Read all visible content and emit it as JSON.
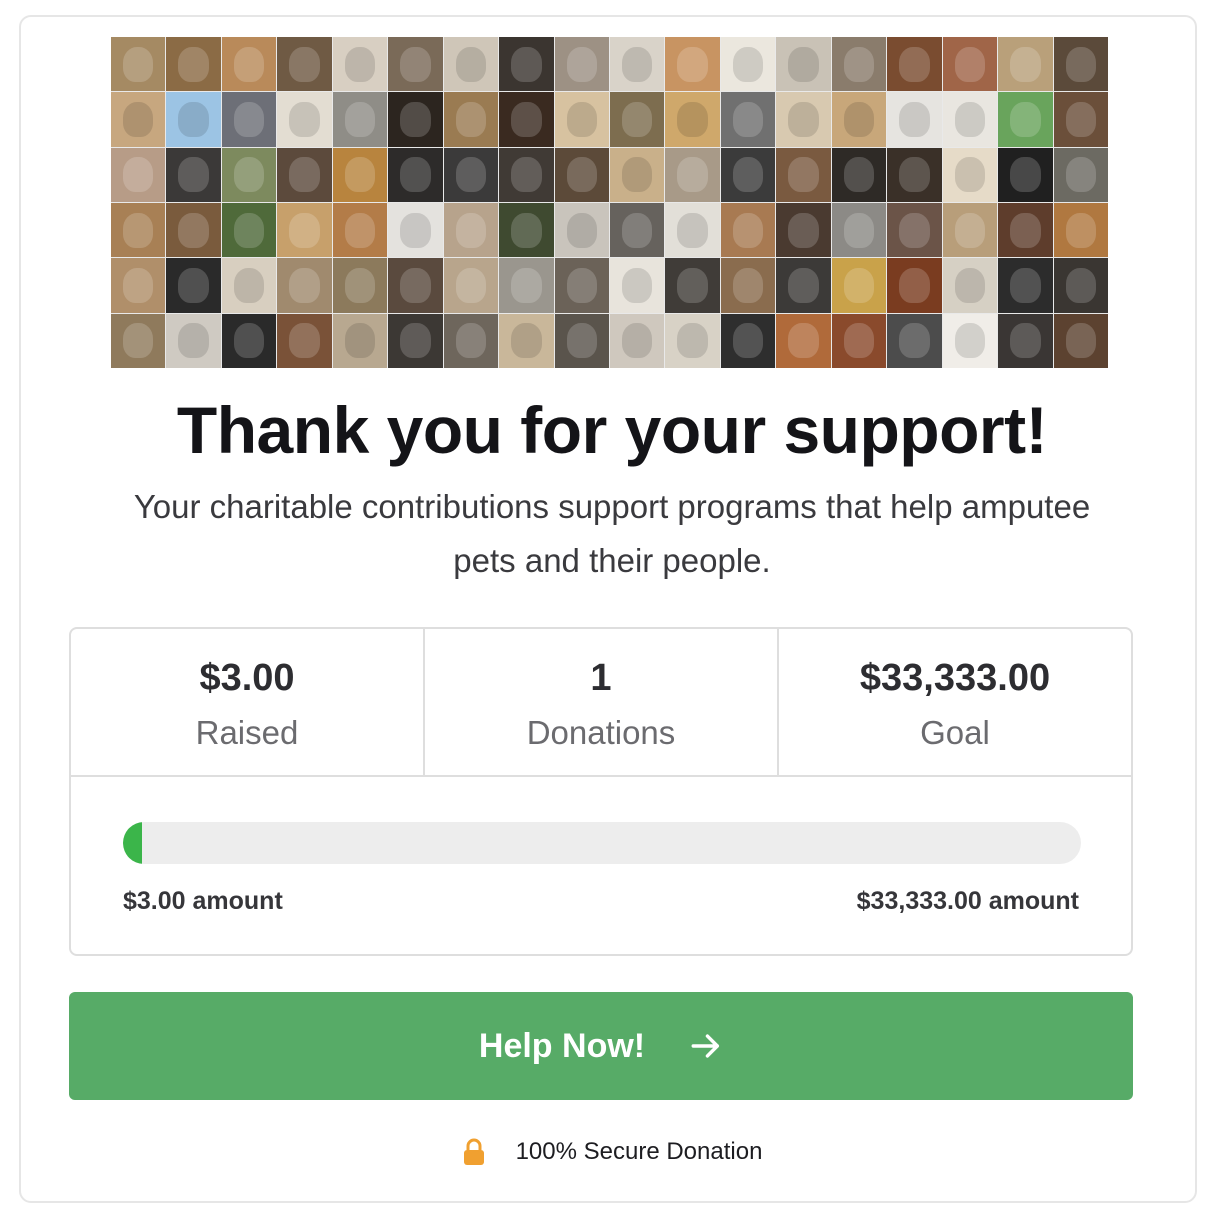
{
  "banner": {
    "alt": "Collage of amputee pet photos",
    "tile_colors": [
      "#a58a63",
      "#8b6b45",
      "#b98a5a",
      "#6f5a44",
      "#d8cfc2",
      "#7a6a58",
      "#cfc6b8",
      "#3b3530",
      "#9d9184",
      "#d9d3c9",
      "#c89462",
      "#ebe7de",
      "#c9c2b6",
      "#8a7c6c",
      "#7a4c30",
      "#a06548",
      "#b9a07a",
      "#5b4a3a",
      "#c7a77f",
      "#9cc4e4",
      "#6d6f77",
      "#e3ddd2",
      "#8f8d87",
      "#2c251f",
      "#9a7b52",
      "#3a2a20",
      "#d7c2a0",
      "#7d6d4f",
      "#cfa86b",
      "#707070",
      "#d8c9b0",
      "#c8a77a",
      "#e6e4e0",
      "#e9e6e0",
      "#69a45c",
      "#6b4f3a",
      "#b79c87",
      "#3b3938",
      "#7d8a5e",
      "#5c4a3c",
      "#b8843e",
      "#2d2b2a",
      "#3b3a3a",
      "#403a35",
      "#5c4a39",
      "#c9b08a",
      "#a89a88",
      "#3b3b3b",
      "#7a5a40",
      "#2e2a26",
      "#3a3028",
      "#e6dbc8",
      "#202020",
      "#6c6a62",
      "#a88055",
      "#7a5b3d",
      "#4f6a3a",
      "#c7a06b",
      "#b37c48",
      "#e4e2de",
      "#b7a38c",
      "#3f4a30",
      "#c9c4bc",
      "#66625d",
      "#e2dfd8",
      "#a87a52",
      "#4a3a30",
      "#8c8a86",
      "#6b5448",
      "#b89e7a",
      "#5e3d2c",
      "#b07840",
      "#b08f6a",
      "#2a2a2a",
      "#d8cfc0",
      "#a08a6e",
      "#8c7a5c",
      "#5a4a3e",
      "#b8a58c",
      "#9a968e",
      "#6b6258",
      "#e8e4dc",
      "#403c38",
      "#8a6c4e",
      "#3c3a38",
      "#c9a24a",
      "#7a3c20",
      "#d6d0c4",
      "#2c2c2c",
      "#3a3632",
      "#8f7a5c",
      "#cfcac2",
      "#2a2a2a",
      "#7a5238",
      "#b8a890",
      "#3c3834",
      "#6e665c",
      "#c9b79a",
      "#5a544c",
      "#cfc8be",
      "#d8d2c6",
      "#2e2e2e",
      "#b06a3a",
      "#8a4a2c",
      "#4c4c4c",
      "#f0ede8",
      "#3a3634",
      "#5c4230"
    ]
  },
  "heading": {
    "title": "Thank you for your support!",
    "subtitle": "Your charitable contributions support programs that help amputee pets and their people."
  },
  "stats": [
    {
      "value": "$3.00",
      "label": "Raised"
    },
    {
      "value": "1",
      "label": "Donations"
    },
    {
      "value": "$33,333.00",
      "label": "Goal"
    }
  ],
  "progress": {
    "fraction": 0.02,
    "min_label": "$3.00 amount",
    "max_label": "$33,333.00 amount",
    "fill_color": "#3bb54a",
    "track_color": "#ededed"
  },
  "cta": {
    "label": "Help Now!",
    "icon": "arrow-right-icon",
    "color": "#57ab67"
  },
  "secure": {
    "text": "100% Secure Donation",
    "icon": "lock-icon",
    "icon_color": "#f0a030"
  }
}
